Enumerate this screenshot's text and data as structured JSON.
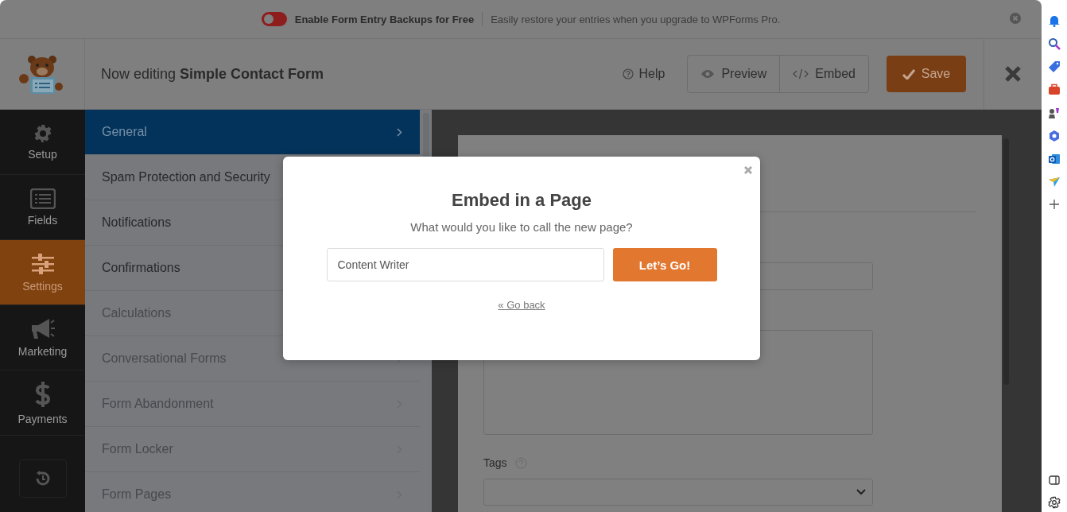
{
  "banner": {
    "toggle": {
      "on": false
    },
    "title": "Enable Form Entry Backups for Free",
    "message": "Easily restore your entries when you upgrade to WPForms Pro."
  },
  "header": {
    "title": "Now editing **Simple Contact Form**",
    "help": "Help",
    "buttons": [
      {
        "kind": "preview",
        "label": "Preview"
      },
      {
        "kind": "embed",
        "label": "Embed"
      }
    ],
    "save": "Save"
  },
  "nav": [
    {
      "kind": "setup",
      "label": "Setup",
      "selected": false
    },
    {
      "kind": "fields",
      "label": "Fields",
      "selected": false
    },
    {
      "kind": "settings",
      "label": "Settings",
      "selected": true
    },
    {
      "kind": "marketing",
      "label": "Marketing",
      "selected": false
    },
    {
      "kind": "payments",
      "label": "Payments",
      "selected": false
    }
  ],
  "settings_menu": [
    {
      "label": "General",
      "selected": true,
      "disabled": false
    },
    {
      "label": "Spam Protection and Security",
      "selected": false,
      "disabled": false
    },
    {
      "label": "Notifications",
      "selected": false,
      "disabled": false
    },
    {
      "label": "Confirmations",
      "selected": false,
      "disabled": false
    },
    {
      "label": "Calculations",
      "selected": false,
      "disabled": true
    },
    {
      "label": "Conversational Forms",
      "selected": false,
      "disabled": true
    },
    {
      "label": "Form Abandonment",
      "selected": false,
      "disabled": true
    },
    {
      "label": "Form Locker",
      "selected": false,
      "disabled": true
    },
    {
      "label": "Form Pages",
      "selected": false,
      "disabled": true
    }
  ],
  "form_preview": {
    "tags_label": "Tags"
  },
  "modal": {
    "title": "Embed in a Page",
    "prompt": "What would you like to call the new page?",
    "input": {
      "value": "Content Writer"
    },
    "button": "Let’s Go!",
    "back_link": "« Go back"
  }
}
